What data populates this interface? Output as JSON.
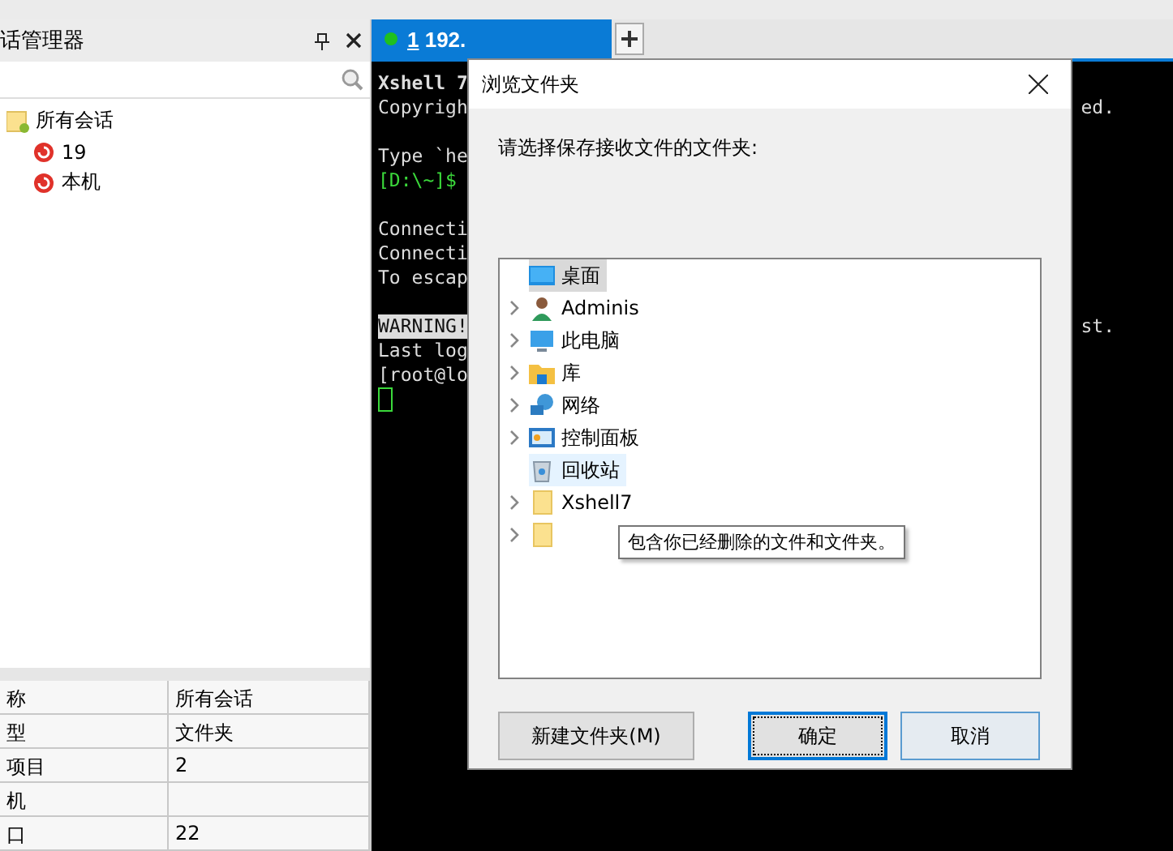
{
  "session_panel": {
    "title": "话管理器",
    "tree": [
      {
        "label": "所有会话",
        "kind": "folder",
        "children": [
          {
            "label": "19",
            "kind": "session"
          },
          {
            "label": "本机",
            "kind": "session"
          }
        ]
      }
    ],
    "properties": [
      {
        "name": "称",
        "value": "所有会话"
      },
      {
        "name": "型",
        "value": "文件夹"
      },
      {
        "name": "项目",
        "value": "2"
      },
      {
        "name": "机"
      },
      {
        "name": "口",
        "value": "22"
      }
    ]
  },
  "tabs": [
    {
      "number": "1",
      "label": " 192.",
      "selected": true,
      "connected": true
    }
  ],
  "terminal": {
    "blocks": [
      {
        "lines": [
          {
            "text": "Xshell 7",
            "bold": true
          },
          {
            "text": "Copyrigh",
            "right": "ed."
          }
        ]
      },
      {
        "lines": [
          {
            "text": "Type `he"
          },
          {
            "text": "[D:\\~]$",
            "prompt": true
          }
        ]
      },
      {
        "lines": [
          {
            "text": "Connecti"
          },
          {
            "text": "Connecti"
          },
          {
            "text": "To escap"
          }
        ]
      },
      {
        "lines": [
          {
            "text": "WARNING!",
            "right": "st.",
            "inverse": true
          },
          {
            "text": "Last log"
          },
          {
            "text": "[root@lo"
          }
        ]
      }
    ]
  },
  "dialog": {
    "title": "浏览文件夹",
    "prompt": "请选择保存接收文件的文件夹:",
    "items": [
      {
        "label": "桌面",
        "kind": "desktop",
        "selected": true,
        "hovered": false,
        "expandable": false
      },
      {
        "label": "Adminis",
        "kind": "user",
        "selected": false,
        "hovered": false,
        "expandable": true
      },
      {
        "label": "此电脑",
        "kind": "computer",
        "selected": false,
        "hovered": false,
        "expandable": true
      },
      {
        "label": "库",
        "kind": "library",
        "selected": false,
        "hovered": false,
        "expandable": true
      },
      {
        "label": "网络",
        "kind": "network",
        "selected": false,
        "hovered": false,
        "expandable": true
      },
      {
        "label": "控制面板",
        "kind": "control",
        "selected": false,
        "hovered": false,
        "expandable": true
      },
      {
        "label": "回收站",
        "kind": "recycle",
        "selected": false,
        "hovered": true,
        "expandable": false
      },
      {
        "label": "Xshell7",
        "kind": "folder",
        "selected": false,
        "hovered": false,
        "expandable": true
      },
      {
        "kind": "folder",
        "selected": false,
        "hovered": false,
        "expandable": true
      }
    ],
    "tooltip": "包含你已经删除的文件和文件夹。",
    "buttons": [
      {
        "label": "新建文件夹(M)",
        "kind": "normal"
      },
      {
        "label": "确定",
        "kind": "default"
      },
      {
        "label": "取消",
        "kind": "hover"
      }
    ]
  }
}
